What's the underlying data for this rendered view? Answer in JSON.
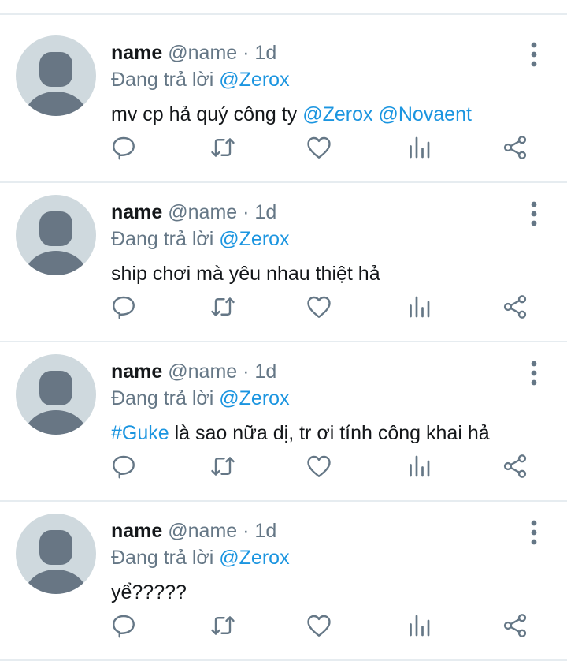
{
  "tweets": [
    {
      "name": "name",
      "handle": "@name",
      "dot": "·",
      "time": "1d",
      "replying_prefix": "Đang trả lời ",
      "replying_to": "@Zerox",
      "body_parts": [
        {
          "text": "mv cp hả quý công ty ",
          "type": "text"
        },
        {
          "text": "@Zerox",
          "type": "mention"
        },
        {
          "text": " ",
          "type": "text"
        },
        {
          "text": "@Novaent",
          "type": "mention"
        }
      ]
    },
    {
      "name": "name",
      "handle": "@name",
      "dot": "·",
      "time": "1d",
      "replying_prefix": "Đang trả lời ",
      "replying_to": "@Zerox",
      "body_parts": [
        {
          "text": "ship chơi mà yêu nhau thiệt hả",
          "type": "text"
        }
      ]
    },
    {
      "name": "name",
      "handle": "@name",
      "dot": "·",
      "time": "1d",
      "replying_prefix": "Đang trả lời ",
      "replying_to": "@Zerox",
      "body_parts": [
        {
          "text": "#Guke",
          "type": "mention"
        },
        {
          "text": " là sao nữa dị, tr ơi tính công khai hả",
          "type": "text"
        }
      ]
    },
    {
      "name": "name",
      "handle": "@name",
      "dot": "·",
      "time": "1d",
      "replying_prefix": "Đang trả lời ",
      "replying_to": "@Zerox",
      "body_parts": [
        {
          "text": "yể?????",
          "type": "text"
        }
      ]
    }
  ],
  "icons": {
    "avatar": "default-avatar-icon",
    "menu": "more-vertical-icon",
    "reply": "reply-icon",
    "retweet": "retweet-icon",
    "like": "heart-icon",
    "stats": "analytics-icon",
    "share": "share-icon"
  },
  "colors": {
    "mention": "#1b95e0",
    "secondary_text": "#657786",
    "avatar_bg": "#cfd9de",
    "avatar_fg": "#687684",
    "icon": "#657786",
    "divider": "#e6ecf0"
  }
}
